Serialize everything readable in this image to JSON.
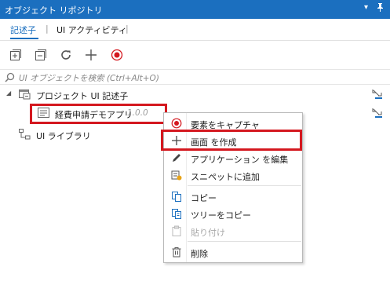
{
  "window": {
    "title": "オブジェクト リポジトリ"
  },
  "tabs": [
    {
      "label": "記述子"
    },
    {
      "label": "UI アクティビティ"
    }
  ],
  "toolbar": {
    "buttons": [
      "expand-all-icon",
      "collapse-all-icon",
      "refresh-icon",
      "add-icon",
      "record-icon"
    ]
  },
  "search": {
    "placeholder": "UI オブジェクトを検索 (Ctrl+Alt+O)"
  },
  "tree": {
    "project": {
      "label": "プロジェクト UI 記述子"
    },
    "app": {
      "label": "経費申請デモアプリ",
      "version": "1.0.0"
    },
    "library": {
      "label": "UI ライブラリ"
    }
  },
  "context_menu": {
    "items": [
      {
        "label": "要素をキャプチャ",
        "icon": "record-icon",
        "disabled": false
      },
      {
        "label": "画面 を作成",
        "icon": "plus-icon",
        "disabled": false
      },
      {
        "label": "アプリケーション を編集",
        "icon": "pencil-icon",
        "disabled": false
      },
      {
        "label": "スニペットに追加",
        "icon": "snippet-icon",
        "disabled": false
      },
      {
        "label": "コピー",
        "icon": "copy-icon",
        "disabled": false
      },
      {
        "label": "ツリーをコピー",
        "icon": "copy-tree-icon",
        "disabled": false
      },
      {
        "label": "貼り付け",
        "icon": "paste-icon",
        "disabled": true
      },
      {
        "label": "削除",
        "icon": "delete-icon",
        "disabled": false
      }
    ]
  },
  "colors": {
    "titlebar": "#1b6fbf",
    "accent": "#1b6fbf",
    "highlight": "#d4181f",
    "record": "#d4181f"
  }
}
